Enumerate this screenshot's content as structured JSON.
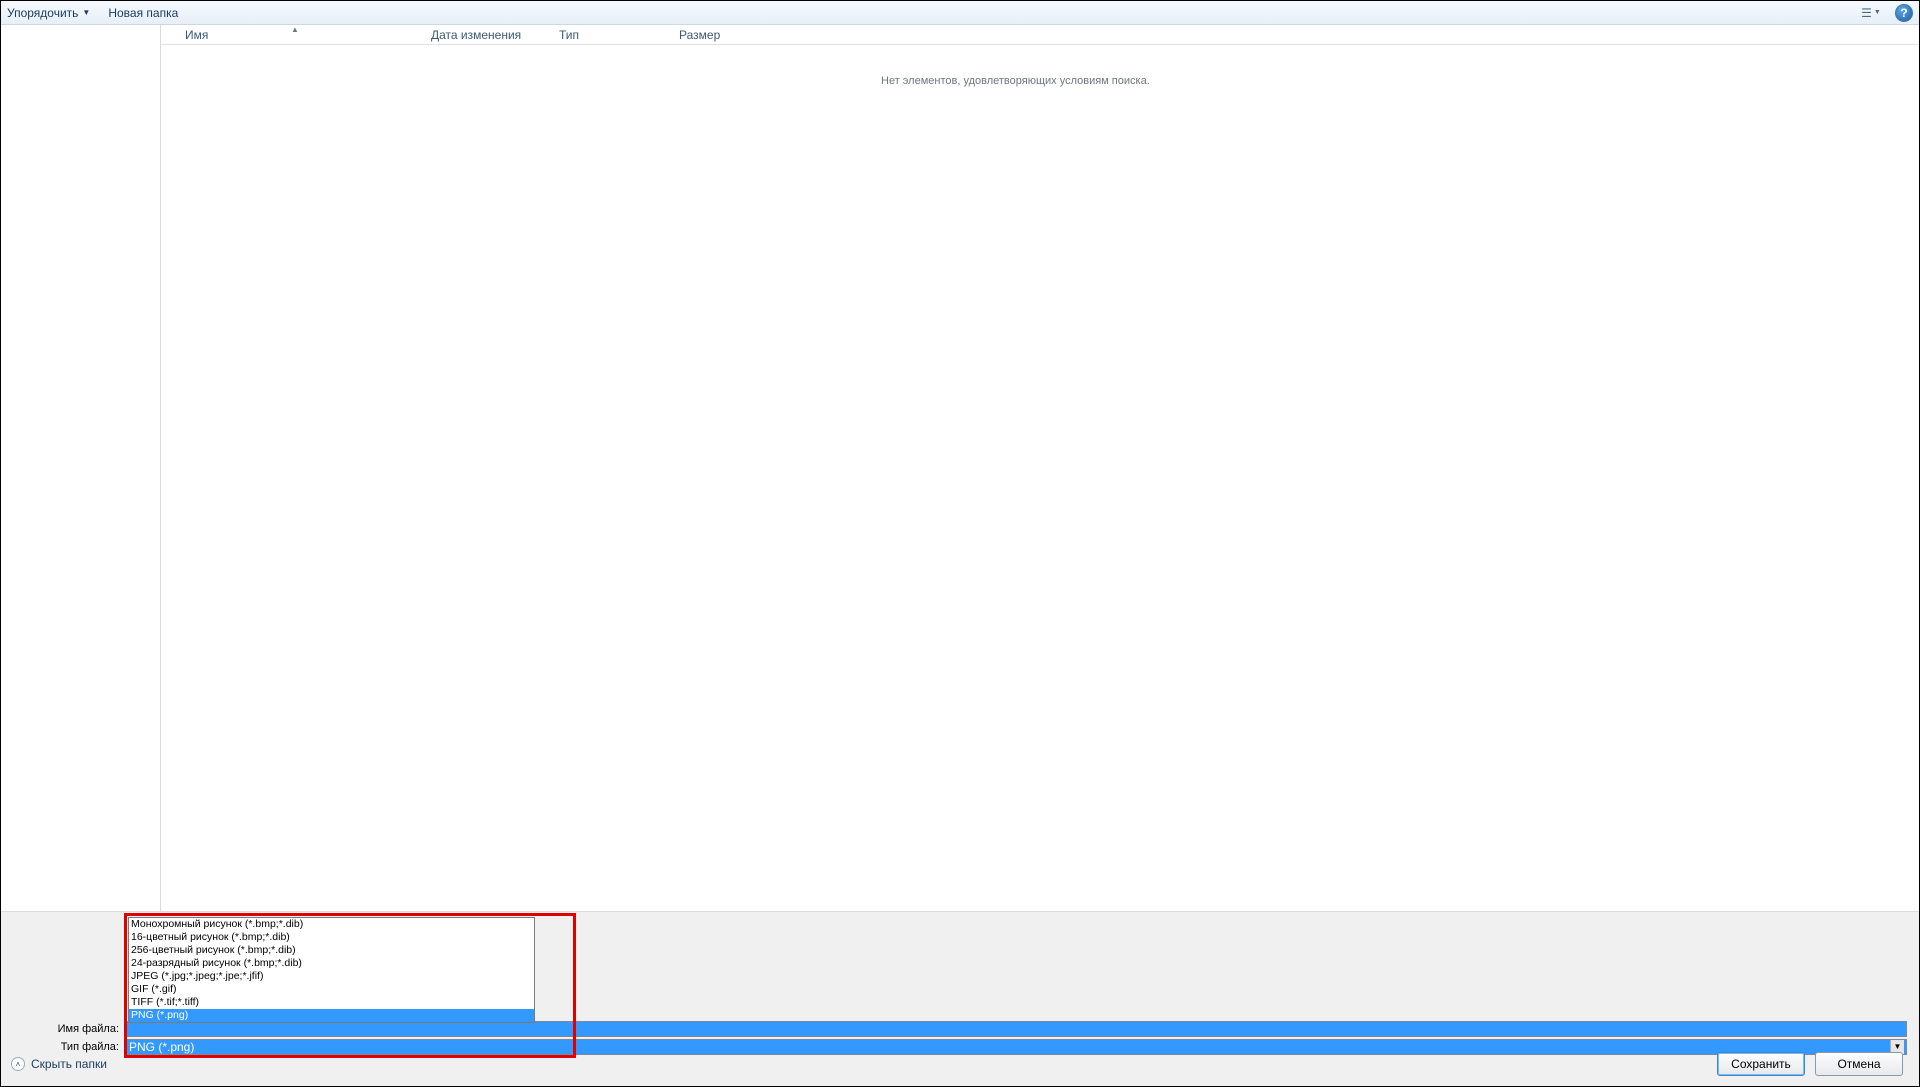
{
  "toolbar": {
    "organize_label": "Упорядочить",
    "newfolder_label": "Новая папка"
  },
  "columns": {
    "name": "Имя",
    "modified": "Дата изменения",
    "type": "Тип",
    "size": "Размер"
  },
  "file_area": {
    "empty_message": "Нет элементов, удовлетворяющих условиям поиска."
  },
  "labels": {
    "filename": "Имя файла:",
    "filetype": "Тип файла:"
  },
  "filename_value": "",
  "filetype_selected": "PNG (*.png)",
  "filetype_options": [
    "Монохромный рисунок (*.bmp;*.dib)",
    "16-цветный рисунок (*.bmp;*.dib)",
    "256-цветный рисунок (*.bmp;*.dib)",
    "24-разрядный рисунок (*.bmp;*.dib)",
    "JPEG (*.jpg;*.jpeg;*.jpe;*.jfif)",
    "GIF (*.gif)",
    "TIFF (*.tif;*.tiff)",
    "PNG (*.png)"
  ],
  "filetype_selected_index": 7,
  "footer": {
    "hide_folders": "Скрыть папки",
    "save": "Сохранить",
    "cancel": "Отмена"
  }
}
